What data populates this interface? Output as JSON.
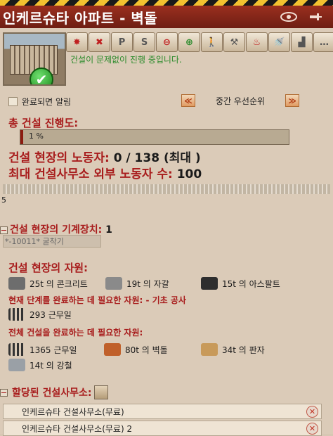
{
  "window": {
    "title": "인케르슈타 아파트 - 벽돌",
    "buttons": [
      "eye-icon",
      "pin-icon"
    ]
  },
  "toolbar": {
    "tools": [
      {
        "name": "dynamite-icon",
        "glyph": "✸"
      },
      {
        "name": "cancel-icon",
        "glyph": "✖"
      },
      {
        "name": "priority-p-icon",
        "glyph": "P"
      },
      {
        "name": "priority-s-icon",
        "glyph": "S"
      },
      {
        "name": "decrease-icon",
        "glyph": "⊖"
      },
      {
        "name": "increase-icon",
        "glyph": "⊕"
      },
      {
        "name": "worker-icon",
        "glyph": "🚶"
      },
      {
        "name": "crane-icon",
        "glyph": "⚒"
      },
      {
        "name": "heating-icon",
        "glyph": "♨"
      },
      {
        "name": "water-icon",
        "glyph": "🚿"
      },
      {
        "name": "stairs-icon",
        "glyph": "▟"
      },
      {
        "name": "more-icon",
        "glyph": "…"
      }
    ]
  },
  "status_message": "건설이 문제없이 진행 중입니다.",
  "notify_when_done": "완료되면 알림",
  "priority": {
    "prev": "≪",
    "label": "중간 우선순위",
    "next": "≫"
  },
  "progress": {
    "title": "총 건설 진행도:",
    "percent_text": "1 %",
    "fraction": 0.01
  },
  "workers": {
    "label": "건설 현장의 노동자: ",
    "value": "0 / 138 (최대 )"
  },
  "outside_workers": {
    "label": "최대 건설사무소 외부 노동자 수: ",
    "value": "100"
  },
  "worker_strip_count": "5",
  "machines": {
    "label": "건설 현장의 기계장치: ",
    "value": "1",
    "item": "*-10011* 굴착기"
  },
  "resources": {
    "title": "건설 현장의 자원:",
    "items": [
      {
        "text": "25t 의 콘크리트",
        "icon": "concrete-icon",
        "color": "#6d6d6d"
      },
      {
        "text": "19t 의 자갈",
        "icon": "gravel-icon",
        "color": "#8a8a8a"
      },
      {
        "text": "15t 의 아스팔트",
        "icon": "asphalt-icon",
        "color": "#2e2e2e"
      }
    ]
  },
  "phase": {
    "title": "현재 단계를 완료하는 데 필요한 자원: - 기초 공사",
    "workdays": "293 근무일"
  },
  "whole": {
    "title": "전체 건설을 완료하는 데 필요한 자원:",
    "workdays": "1365 근무일",
    "bricks": "80t 의 벽돌",
    "boards": "34t 의 판자",
    "steel": "14t 의 강철"
  },
  "assigned": {
    "title": "할당된 건설사무소:",
    "offices": [
      "인케르슈타 건설사무소(무료)",
      "인케르슈타 건설사무소(무료) 2"
    ]
  }
}
